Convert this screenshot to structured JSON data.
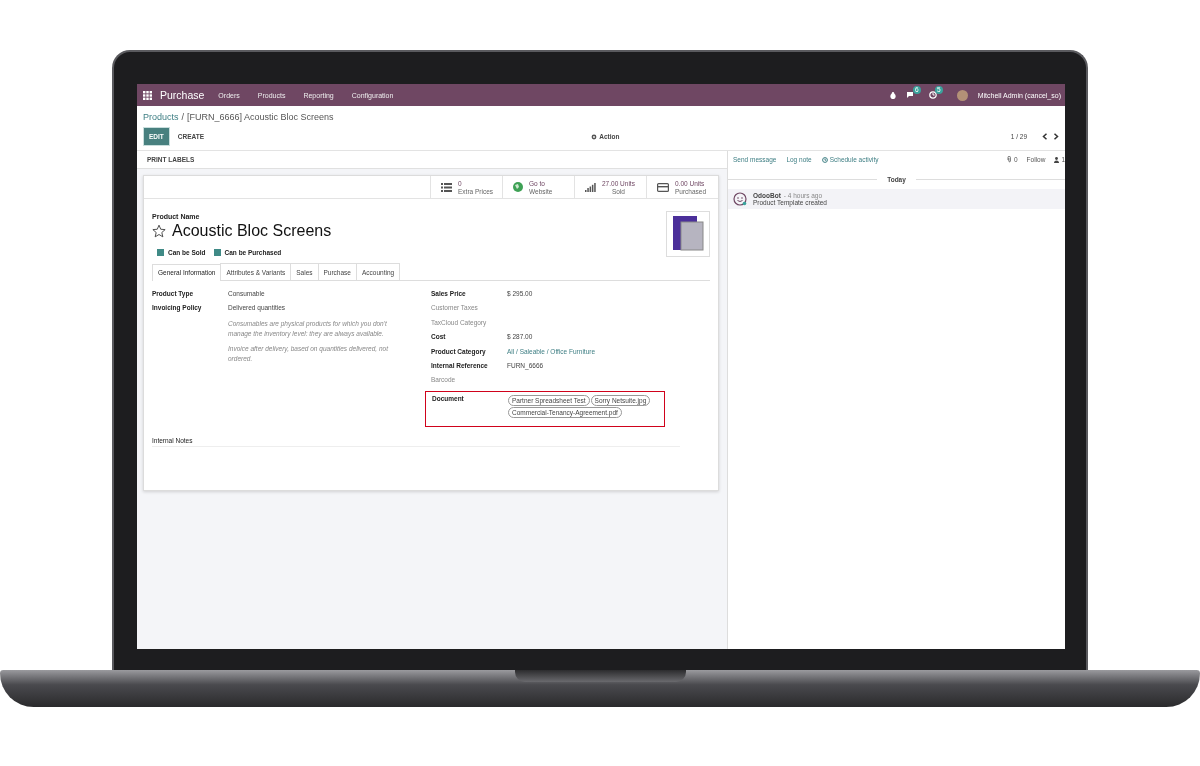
{
  "navbar": {
    "app_name": "Purchase",
    "menu": [
      "Orders",
      "Products",
      "Reporting",
      "Configuration"
    ],
    "messages_count": "6",
    "activities_count": "5",
    "user": "Mitchell Admin (cancel_so)"
  },
  "breadcrumb": {
    "parent": "Products",
    "separator": "/",
    "current": "[FURN_6666] Acoustic Bloc Screens"
  },
  "control_buttons": [
    {
      "label": "EDIT",
      "kind": "primary"
    },
    {
      "label": "CREATE",
      "kind": "secondary"
    }
  ],
  "action": "Action",
  "pager": "1 / 29",
  "status_bar": {
    "button": "PRINT LABELS"
  },
  "smart_buttons": [
    {
      "kind": "list",
      "value": "0",
      "label": "Extra Prices"
    },
    {
      "kind": "globe",
      "value": "Go to",
      "label": "Website"
    },
    {
      "kind": "signal",
      "value": "27.00 Units",
      "label": "Sold"
    },
    {
      "kind": "card",
      "value": "0.00 Units",
      "label": "Purchased"
    }
  ],
  "product": {
    "name_label": "Product Name",
    "name": "Acoustic Bloc Screens",
    "favorite": false,
    "checkboxes": [
      {
        "label": "Can be Sold",
        "checked": true
      },
      {
        "label": "Can be Purchased",
        "checked": true
      }
    ]
  },
  "tabs": [
    {
      "label": "General Information",
      "selected": true
    },
    {
      "label": "Attributes & Variants",
      "selected": false
    },
    {
      "label": "Sales",
      "selected": false
    },
    {
      "label": "Purchase",
      "selected": false
    },
    {
      "label": "Accounting",
      "selected": false
    }
  ],
  "left_fields": [
    {
      "label": "Product Type",
      "value": "Consumable"
    },
    {
      "label": "Invoicing Policy",
      "value": "Delivered quantities"
    }
  ],
  "help_notes": [
    "Consumables are physical products for which you don't manage the inventory level: they are always available.",
    "Invoice after delivery, based on quantities delivered, not ordered."
  ],
  "right_fields": [
    {
      "kind": "text",
      "label": "Sales Price",
      "value": "$ 295.00"
    },
    {
      "kind": "empty",
      "label": "Customer Taxes"
    },
    {
      "kind": "empty",
      "label": "TaxCloud Category"
    },
    {
      "kind": "text",
      "label": "Cost",
      "value": "$ 287.00"
    },
    {
      "kind": "link",
      "label": "Product Category",
      "value": "All / Saleable / Office Furniture"
    },
    {
      "kind": "text",
      "label": "Internal Reference",
      "value": "FURN_6666"
    },
    {
      "kind": "empty",
      "label": "Barcode"
    },
    {
      "kind": "tags",
      "label": "Document",
      "highlighted": true,
      "tags": [
        "Partner Spreadsheet Test",
        "Sorry Netsuite.jpg",
        "Commercial-Tenancy-Agreement.pdf"
      ]
    }
  ],
  "internal_notes_label": "Internal Notes",
  "chatter": {
    "actions": [
      "Send message",
      "Log note",
      "Schedule activity"
    ],
    "attachments": "0",
    "follow": "Follow",
    "followers": "1",
    "date": "Today",
    "messages": [
      {
        "author": "OdooBot",
        "time": "- 4 hours ago",
        "body": "Product Template created"
      }
    ]
  }
}
